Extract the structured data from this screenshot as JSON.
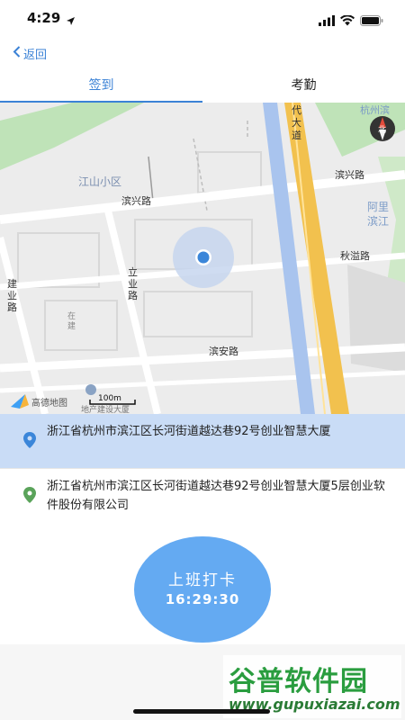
{
  "status_bar": {
    "time": "4:29"
  },
  "nav": {
    "back_label": "返回"
  },
  "tabs": [
    {
      "label": "签到"
    },
    {
      "label": "考勤"
    }
  ],
  "map": {
    "roads": {
      "binxing_left": "滨兴路",
      "binxing_right": "滨兴路",
      "qiuyi": "秋溢路",
      "binan": "滨安路",
      "liye": "立业路",
      "jianye": "建业路",
      "jiangdai": "代大道",
      "zaijian": "在建",
      "hangzhou_top": "杭州滨",
      "ali_1": "阿里",
      "ali_2": "滨江"
    },
    "district_label": "江山小区",
    "compass_label": "北",
    "provider_label": "高德地图",
    "scale_label": "100m",
    "building_label": "地产建设大厦"
  },
  "addresses": [
    {
      "text": "浙江省杭州市滨江区长河街道越达巷92号创业智慧大厦"
    },
    {
      "text": "浙江省杭州市滨江区长河街道越达巷92号创业智慧大厦5层创业软件股份有限公司"
    }
  ],
  "checkin": {
    "label": "上班打卡",
    "time": "16:29:30"
  },
  "watermark": {
    "brand": "谷普软件园",
    "url": "www.gupuxiazai.com"
  },
  "colors": {
    "accent": "#3b82d6",
    "button": "#64aaf2",
    "selected_row": "#c9dcf6",
    "water": "#a9c4ee",
    "expressway": "#f2c14e",
    "green": "#bfe3b8"
  }
}
